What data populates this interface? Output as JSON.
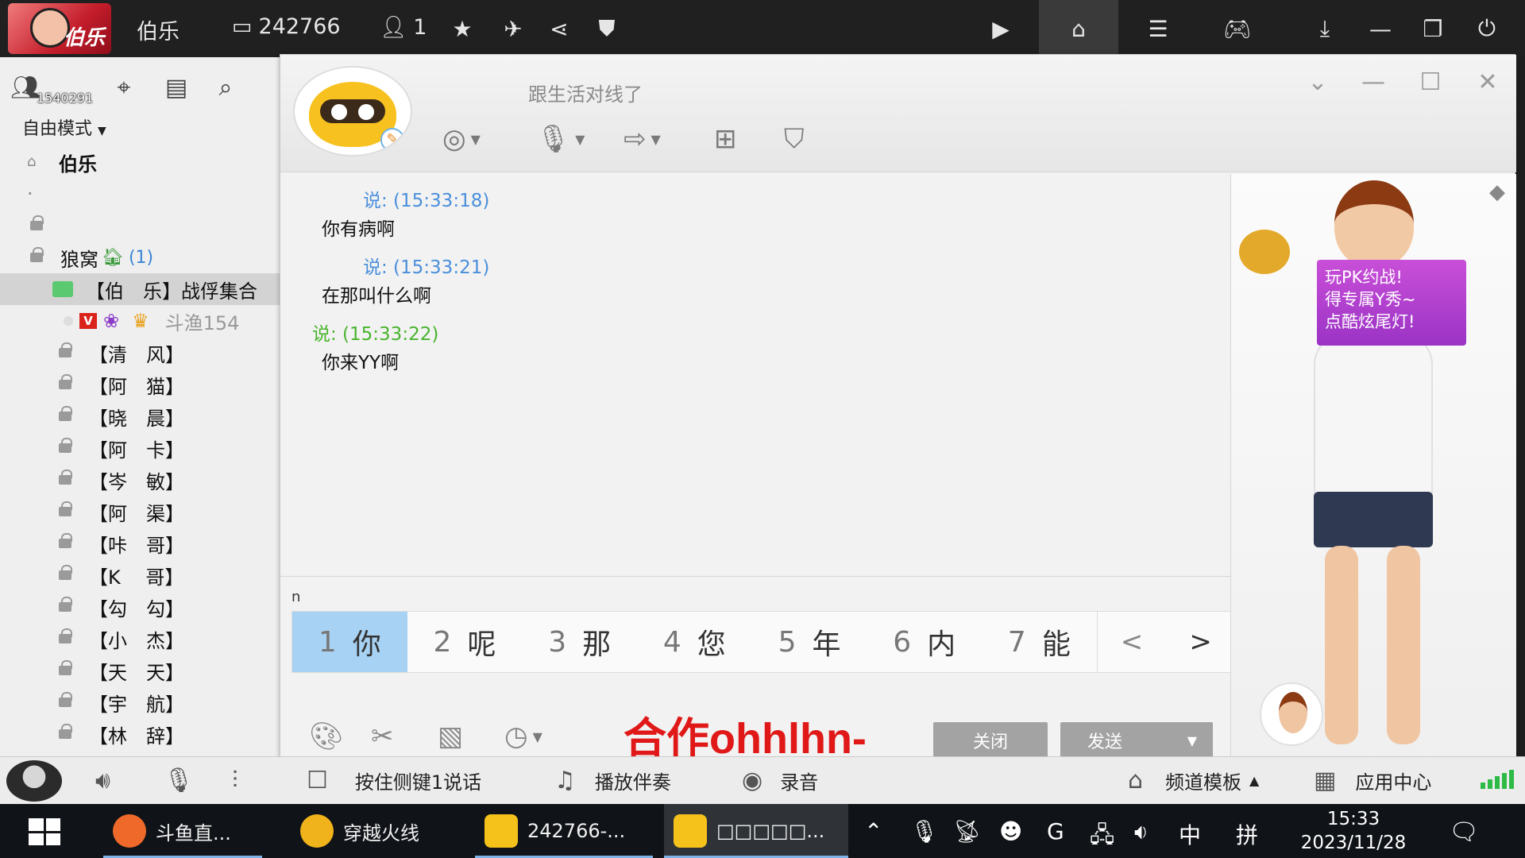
{
  "topbar": {
    "logo_text": "伯乐",
    "username": "伯乐",
    "channel_id": "242766",
    "online_count": "1",
    "icons": [
      "id-card-icon",
      "user-icon",
      "star-icon",
      "plane-icon",
      "share-icon",
      "shield-icon",
      "video-icon",
      "home-icon",
      "list-icon",
      "gamepad-icon",
      "download-icon",
      "minimize-icon",
      "restore-icon",
      "power-icon"
    ]
  },
  "left": {
    "id_overlay": "1540291",
    "mode_label": "自由模式",
    "root_label": "伯乐",
    "dot_item": "·",
    "group_label": "狼窝",
    "group_count": "(1)",
    "selected_channel": "【伯　乐】战俘集合",
    "member_label": "斗渔154",
    "channels": [
      "【清　风】",
      "【阿　猫】",
      "【晓　晨】",
      "【阿　卡】",
      "【岑　敏】",
      "【阿　渠】",
      "【咔　哥】",
      "【K　 哥】",
      "【勾　勾】",
      "【小　杰】",
      "【天　天】",
      "【宇　航】",
      "【林　辞】"
    ]
  },
  "chat": {
    "signature": "跟生活对线了",
    "messages": [
      {
        "time": "说: (15:33:18)",
        "text": "你有病啊"
      },
      {
        "time": "说: (15:33:21)",
        "text": "在那叫什么啊"
      },
      {
        "time": "说: (15:33:22)",
        "text": "你来YY啊"
      }
    ],
    "typed_text": "n",
    "ime_candidates": [
      {
        "num": "1",
        "char": "你"
      },
      {
        "num": "2",
        "char": "呢"
      },
      {
        "num": "3",
        "char": "那"
      },
      {
        "num": "4",
        "char": "您"
      },
      {
        "num": "5",
        "char": "年"
      },
      {
        "num": "6",
        "char": "内"
      },
      {
        "num": "7",
        "char": "能"
      }
    ],
    "ime_prev": "<",
    "ime_next": ">",
    "overlay_text": "合作ohhlhn-",
    "close_button": "关闭",
    "send_button": "发送",
    "pk_banner": [
      "玩PK约战!",
      "得专属Y秀~",
      "点酷炫尾灯!"
    ]
  },
  "bottombar": {
    "ptt_label": "按住侧键1说话",
    "music_label": "播放伴奏",
    "record_label": "录音",
    "template_label": "频道模板",
    "appcenter_label": "应用中心"
  },
  "taskbar": {
    "apps": [
      {
        "label": "斗鱼直..."
      },
      {
        "label": "穿越火线"
      },
      {
        "label": "242766-..."
      },
      {
        "label": "□□□□□..."
      }
    ],
    "ime_mode": "中",
    "ime_layout": "拼",
    "time": "15:33",
    "date": "2023/11/28"
  },
  "colors": {
    "time_blue": "#4a8fdb",
    "time_green": "#49b42e",
    "ime_active": "#a8d2f3",
    "overlay_red": "#e01818"
  }
}
